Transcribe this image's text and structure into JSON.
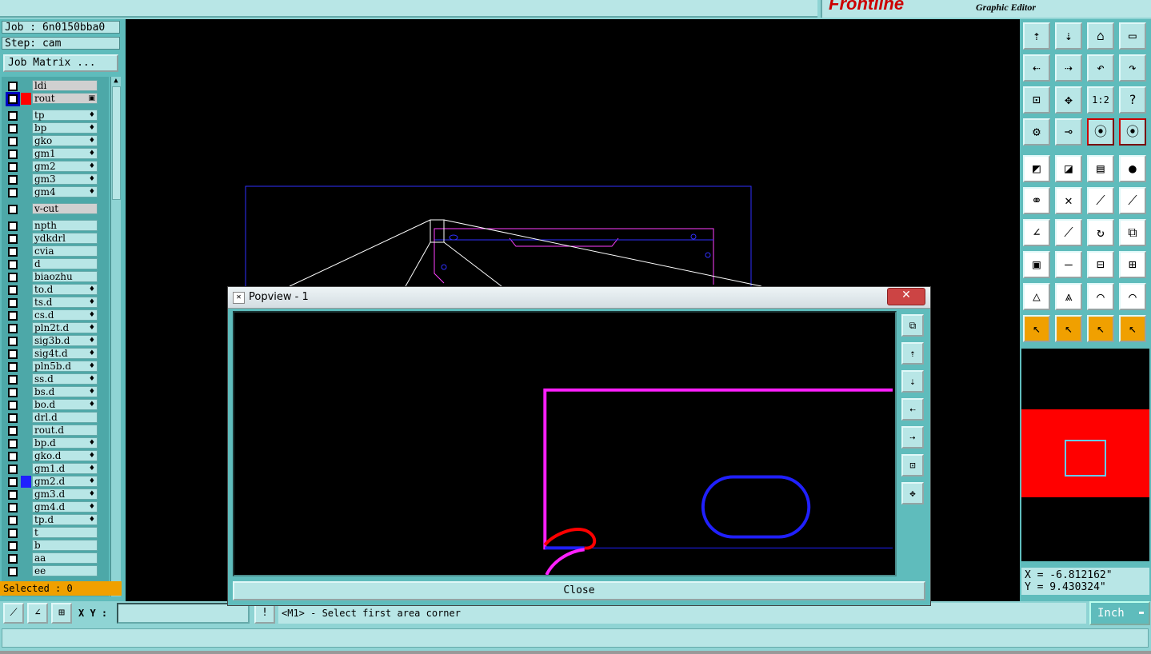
{
  "app": {
    "brand": "Frontline",
    "subtitle": "Graphic Editor"
  },
  "left_panel": {
    "job": "Job : 6n0150bba0",
    "step": "Step: cam",
    "job_matrix": "Job Matrix ...",
    "selected": "Selected : 0",
    "layers": [
      {
        "name": "ldi",
        "color": "",
        "mark": "",
        "group": 0,
        "hl": true
      },
      {
        "name": "rout",
        "color": "#ff0000",
        "mark": "▣",
        "group": 0,
        "hl": true,
        "sel": true
      },
      {
        "name": "tp",
        "color": "",
        "mark": "♦",
        "group": 1
      },
      {
        "name": "bp",
        "color": "",
        "mark": "♦",
        "group": 1
      },
      {
        "name": "gko",
        "color": "",
        "mark": "♦",
        "group": 1
      },
      {
        "name": "gm1",
        "color": "",
        "mark": "♦",
        "group": 1
      },
      {
        "name": "gm2",
        "color": "",
        "mark": "♦",
        "group": 1
      },
      {
        "name": "gm3",
        "color": "",
        "mark": "♦",
        "group": 1
      },
      {
        "name": "gm4",
        "color": "",
        "mark": "♦",
        "group": 1
      },
      {
        "name": "v-cut",
        "color": "",
        "mark": "",
        "group": 2,
        "hl": true
      },
      {
        "name": "npth",
        "color": "",
        "mark": "",
        "group": 3
      },
      {
        "name": "ydkdrl",
        "color": "",
        "mark": "",
        "group": 3
      },
      {
        "name": "cvia",
        "color": "",
        "mark": "",
        "group": 3
      },
      {
        "name": "d",
        "color": "",
        "mark": "",
        "group": 3
      },
      {
        "name": "biaozhu",
        "color": "",
        "mark": "",
        "group": 3
      },
      {
        "name": "to.d",
        "color": "",
        "mark": "♦",
        "group": 3
      },
      {
        "name": "ts.d",
        "color": "",
        "mark": "♦",
        "group": 3
      },
      {
        "name": "cs.d",
        "color": "",
        "mark": "♦",
        "group": 3
      },
      {
        "name": "pln2t.d",
        "color": "",
        "mark": "♦",
        "group": 3
      },
      {
        "name": "sig3b.d",
        "color": "",
        "mark": "♦",
        "group": 3
      },
      {
        "name": "sig4t.d",
        "color": "",
        "mark": "♦",
        "group": 3
      },
      {
        "name": "pln5b.d",
        "color": "",
        "mark": "♦",
        "group": 3
      },
      {
        "name": "ss.d",
        "color": "",
        "mark": "♦",
        "group": 3
      },
      {
        "name": "bs.d",
        "color": "",
        "mark": "♦",
        "group": 3
      },
      {
        "name": "bo.d",
        "color": "",
        "mark": "♦",
        "group": 3
      },
      {
        "name": "drl.d",
        "color": "",
        "mark": "",
        "group": 3
      },
      {
        "name": "rout.d",
        "color": "",
        "mark": "",
        "group": 3
      },
      {
        "name": "bp.d",
        "color": "",
        "mark": "♦",
        "group": 3
      },
      {
        "name": "gko.d",
        "color": "",
        "mark": "♦",
        "group": 3
      },
      {
        "name": "gm1.d",
        "color": "",
        "mark": "♦",
        "group": 3
      },
      {
        "name": "gm2.d",
        "color": "#2020ff",
        "mark": "♦",
        "group": 3
      },
      {
        "name": "gm3.d",
        "color": "",
        "mark": "♦",
        "group": 3
      },
      {
        "name": "gm4.d",
        "color": "",
        "mark": "♦",
        "group": 3
      },
      {
        "name": "tp.d",
        "color": "",
        "mark": "♦",
        "group": 3
      },
      {
        "name": "t",
        "color": "",
        "mark": "",
        "group": 3
      },
      {
        "name": "b",
        "color": "",
        "mark": "",
        "group": 3
      },
      {
        "name": "aa",
        "color": "",
        "mark": "",
        "group": 3
      },
      {
        "name": "ee",
        "color": "",
        "mark": "",
        "group": 3
      }
    ]
  },
  "right_panel": {
    "coords_x": "X = -6.812162\"",
    "coords_y": "Y = 9.430324\"",
    "tool_icons": [
      [
        "page-up-icon",
        "page-down-icon",
        "home-icon",
        "window-icon"
      ],
      [
        "page-left-icon",
        "page-right-icon",
        "undo-view-icon",
        "redo-view-icon"
      ],
      [
        "fit-icon",
        "zoom-icon",
        "scale-1-2-icon",
        "help-icon"
      ],
      [
        "settings-icon",
        "measure-icon",
        "snap-icon",
        "snap2-icon"
      ],
      [
        "select-feature-icon",
        "draw-icon",
        "ruler-icon",
        "pad-icon"
      ],
      [
        "connect-icon",
        "cross-icon",
        "line-icon",
        "line2-icon"
      ],
      [
        "angle-icon",
        "slash-icon",
        "rotate-icon",
        "mirror-icon"
      ],
      [
        "move-icon",
        "split-icon",
        "resize-icon",
        "group-icon"
      ],
      [
        "triangle-icon",
        "up-arrow-icon",
        "arch-icon",
        "arch2-icon"
      ],
      [
        "pointer-icon",
        "pointer-box-icon",
        "pointer-round-icon",
        "pointer-tree-icon"
      ]
    ],
    "one_to_two_label": "1:2",
    "help_label": "?"
  },
  "bottom": {
    "xy_label": "X Y :",
    "xy_value": "",
    "prompt": "<M1> - Select first area corner",
    "unit": "Inch"
  },
  "popup": {
    "title": "Popview - 1",
    "close_label": "Close",
    "close_x": "✕"
  },
  "colors": {
    "panel": "#5fbcbc",
    "field": "#b8e6e6",
    "magenta": "#ff20ff",
    "blue": "#2020ff",
    "red": "#ff0000",
    "orange": "#f0a000"
  }
}
